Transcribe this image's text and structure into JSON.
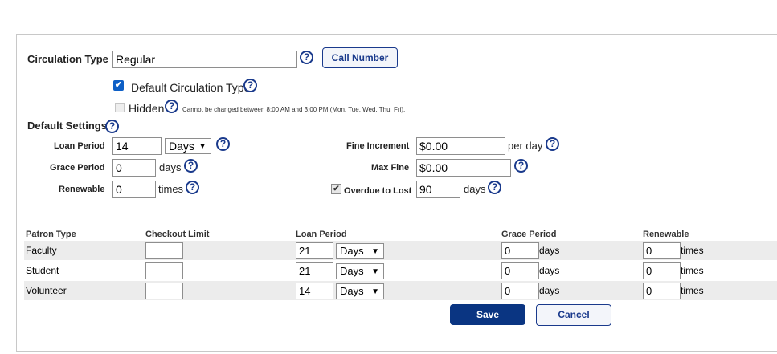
{
  "circulation": {
    "label": "Circulation Type",
    "value": "Regular",
    "call_number_button": "Call Number",
    "default_type_label": "Default Circulation Type",
    "hidden_label": "Hidden",
    "hidden_note": "Cannot be changed between 8:00 AM and 3:00 PM (Mon, Tue, Wed, Thu, Fri)."
  },
  "default_settings": {
    "heading": "Default Settings",
    "loan_period_label": "Loan Period",
    "loan_period_value": "14",
    "loan_period_unit": "Days",
    "grace_period_label": "Grace Period",
    "grace_period_value": "0",
    "grace_period_unit": "days",
    "renewable_label": "Renewable",
    "renewable_value": "0",
    "renewable_unit": "times",
    "fine_increment_label": "Fine Increment",
    "fine_increment_value": "$0.00",
    "fine_increment_unit": "per day",
    "max_fine_label": "Max Fine",
    "max_fine_value": "$0.00",
    "overdue_label": "Overdue to Lost",
    "overdue_value": "90",
    "overdue_unit": "days"
  },
  "table": {
    "headers": {
      "patron_type": "Patron Type",
      "checkout_limit": "Checkout Limit",
      "loan_period": "Loan Period",
      "grace_period": "Grace Period",
      "renewable": "Renewable"
    },
    "rows": [
      {
        "patron": "Faculty",
        "checkout": "",
        "loan": "21",
        "loan_unit": "Days",
        "grace": "0",
        "grace_unit": "days",
        "renew": "0",
        "renew_unit": "times"
      },
      {
        "patron": "Student",
        "checkout": "",
        "loan": "21",
        "loan_unit": "Days",
        "grace": "0",
        "grace_unit": "days",
        "renew": "0",
        "renew_unit": "times"
      },
      {
        "patron": "Volunteer",
        "checkout": "",
        "loan": "14",
        "loan_unit": "Days",
        "grace": "0",
        "grace_unit": "days",
        "renew": "0",
        "renew_unit": "times"
      }
    ]
  },
  "actions": {
    "save": "Save",
    "cancel": "Cancel"
  },
  "icons": {
    "help": "?",
    "check": "✔",
    "dropdown": "▼"
  },
  "colors": {
    "accent": "#1a3a8c",
    "primary_button": "#0a3582",
    "checkbox": "#0d5fc6",
    "row_shade": "#ececec"
  }
}
